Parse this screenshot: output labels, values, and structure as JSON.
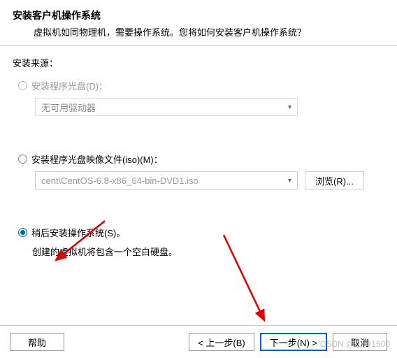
{
  "header": {
    "title": "安装客户机操作系统",
    "subtitle": "虚拟机如同物理机，需要操作系统。您将如何安装客户机操作系统？"
  },
  "source_label": "安装来源：",
  "option_disc": {
    "label": "安装程序光盘(D)：",
    "dropdown_value": "无可用驱动器"
  },
  "option_iso": {
    "label": "安装程序光盘映像文件(iso)(M)：",
    "path_value": "cent\\CentOS-6.8-x86_64-bin-DVD1.iso",
    "browse_label": "浏览(R)..."
  },
  "option_later": {
    "label": "稍后安装操作系统(S)。",
    "description": "创建的虚拟机将包含一个空白硬盘。"
  },
  "footer": {
    "help": "帮助",
    "back": "< 上一步(B)",
    "next": "下一步(N) >",
    "cancel": "取消"
  },
  "watermark": "CSDN @小黄1500"
}
